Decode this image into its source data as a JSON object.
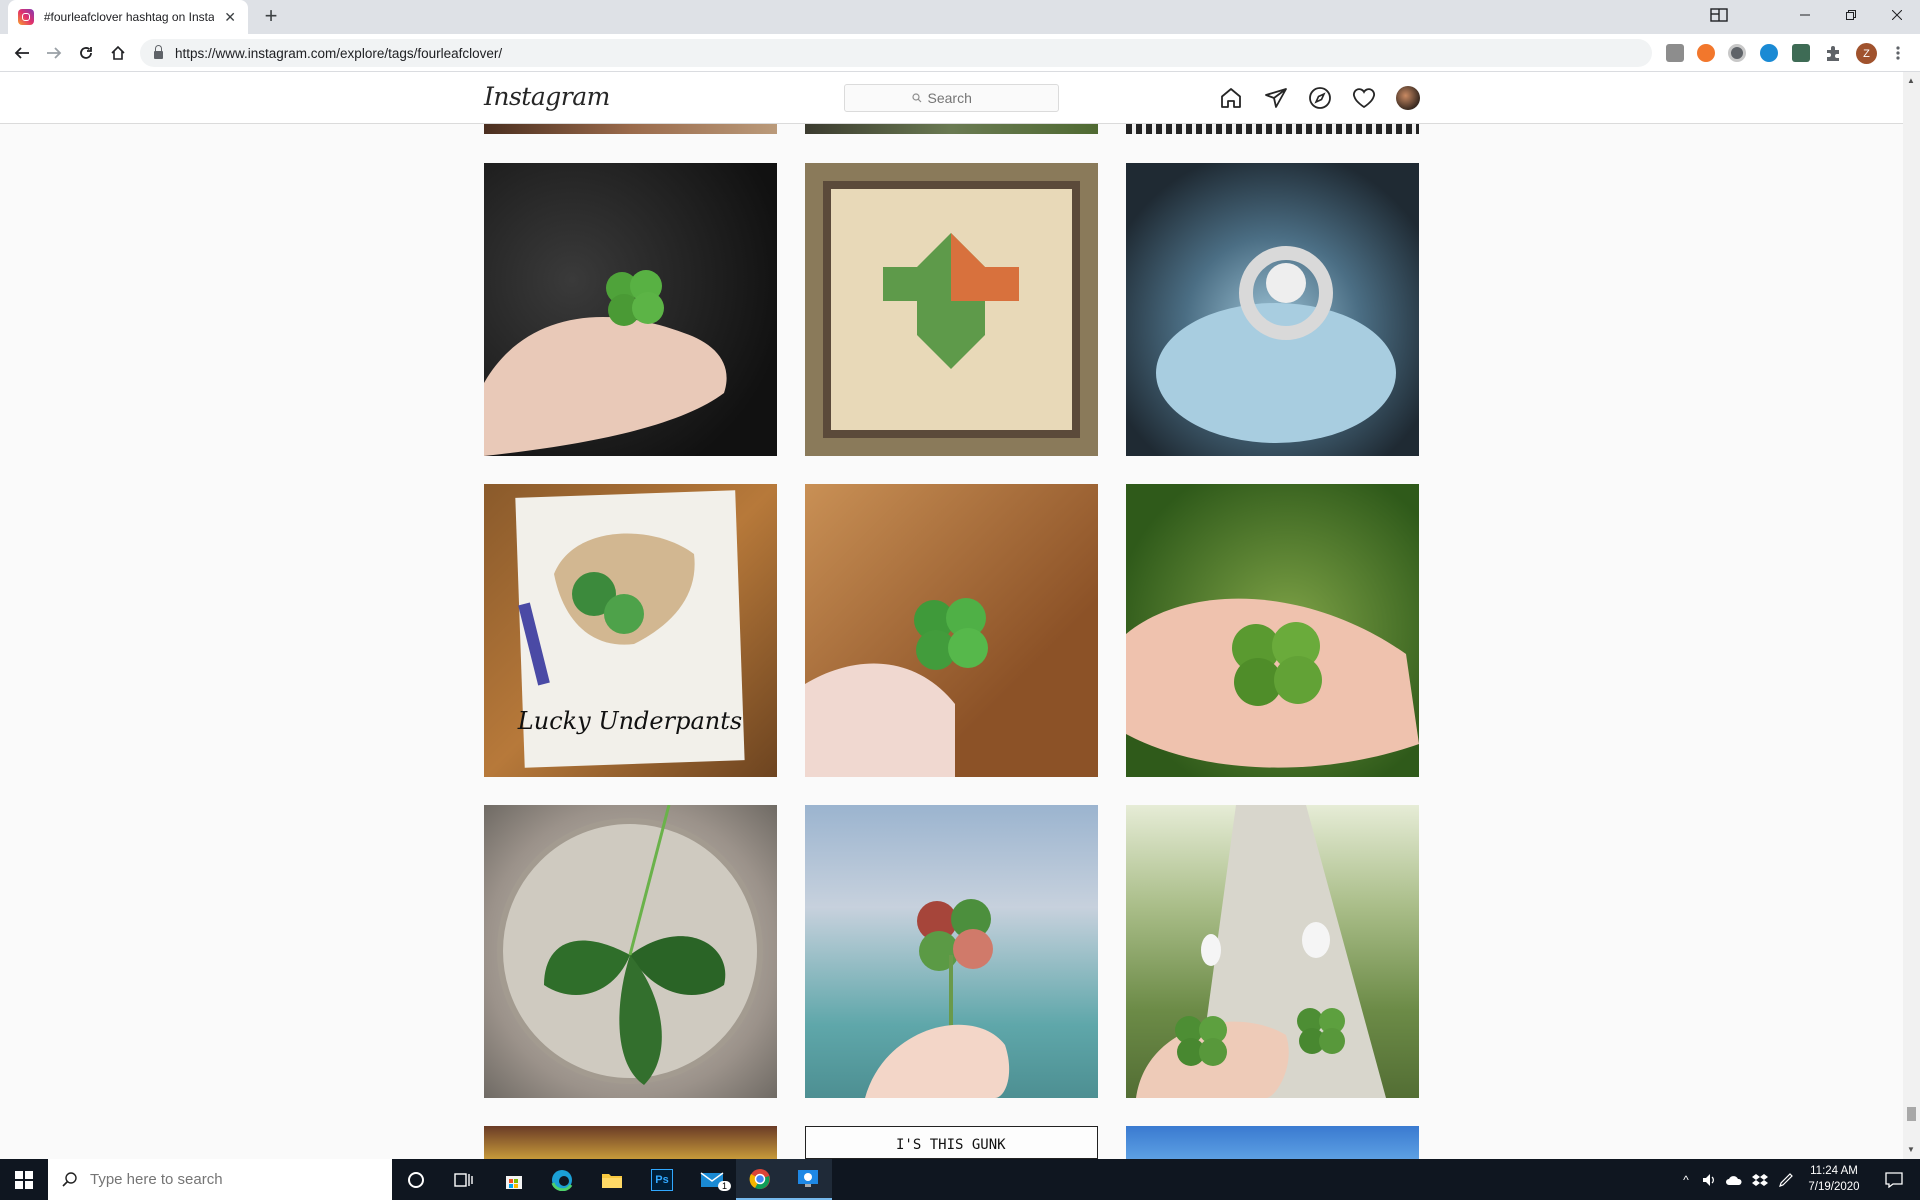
{
  "browser": {
    "tab_title": "#fourleafclover hashtag on Instagram",
    "tab_close": "✕",
    "new_tab": "+",
    "url": "https://www.instagram.com/explore/tags/fourleafclover/",
    "profile_initial": "Z"
  },
  "instagram": {
    "logo": "Instagram",
    "search_placeholder": "Search"
  },
  "grid": {
    "posts": [
      {
        "caption_art": ""
      },
      {
        "caption_art": ""
      },
      {
        "caption_art": ""
      },
      {
        "caption_art": "Lucky Underpants"
      },
      {
        "caption_art": ""
      },
      {
        "caption_art": ""
      },
      {
        "caption_art": ""
      },
      {
        "caption_art": ""
      },
      {
        "caption_art": ""
      }
    ],
    "partial_bottom_text": "I'S THIS GUNK"
  },
  "taskbar": {
    "search_placeholder": "Type here to search",
    "mail_badge": "1",
    "time": "11:24 AM",
    "date": "7/19/2020"
  },
  "colors": {
    "chrome_tabstrip": "#dee1e6",
    "ig_border": "#dbdbdb",
    "taskbar": "#0f1620"
  }
}
